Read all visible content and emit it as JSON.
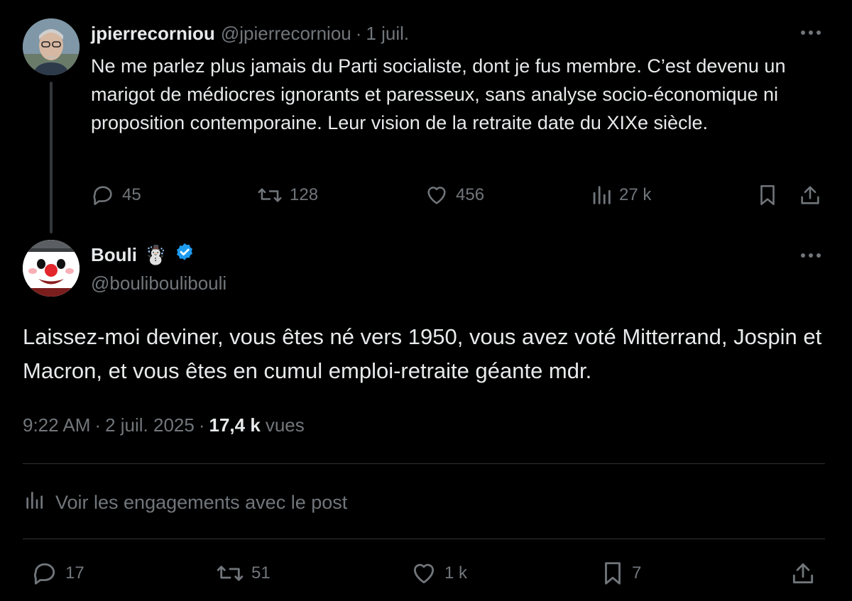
{
  "parent_post": {
    "author_name": "jpierrecorniou",
    "author_handle": "@jpierrecorniou",
    "date": "1 juil.",
    "separator": "·",
    "text": "Ne me parlez plus jamais du Parti socialiste, dont je fus membre. C’est devenu un marigot de médiocres ignorants et paresseux, sans analyse socio-économique ni proposition contemporaine. Leur vision de la retraite date du XIXe siècle.",
    "replies": "45",
    "reposts": "128",
    "likes": "456",
    "views": "27 k"
  },
  "main_post": {
    "author_name": "Bouli",
    "author_emoji": "☃️",
    "author_handle": "@bouliboulibouli",
    "text": "Laissez-moi deviner, vous êtes né vers 1950, vous avez voté Mitterrand, Jospin et Macron, et vous êtes en cumul emploi-retraite géante mdr.",
    "time": "9:22 AM",
    "date": "2 juil. 2025",
    "separator": "·",
    "views_count": "17,4 k",
    "views_label": "vues",
    "engagements_label": "Voir les engagements avec le post",
    "replies": "17",
    "reposts": "51",
    "likes": "1 k",
    "bookmarks": "7"
  },
  "icons": {
    "reply": "speech-bubble-icon",
    "repost": "repost-arrows-icon",
    "like": "heart-icon",
    "views": "bar-chart-icon",
    "bookmark": "bookmark-icon",
    "share": "share-upload-icon",
    "more": "ellipsis-icon",
    "verified": "verified-badge-icon"
  },
  "colors": {
    "background": "#000000",
    "text_primary": "#e7e9ea",
    "text_secondary": "#71767b",
    "divider": "#2f3336",
    "verified_blue": "#1d9bf0"
  }
}
